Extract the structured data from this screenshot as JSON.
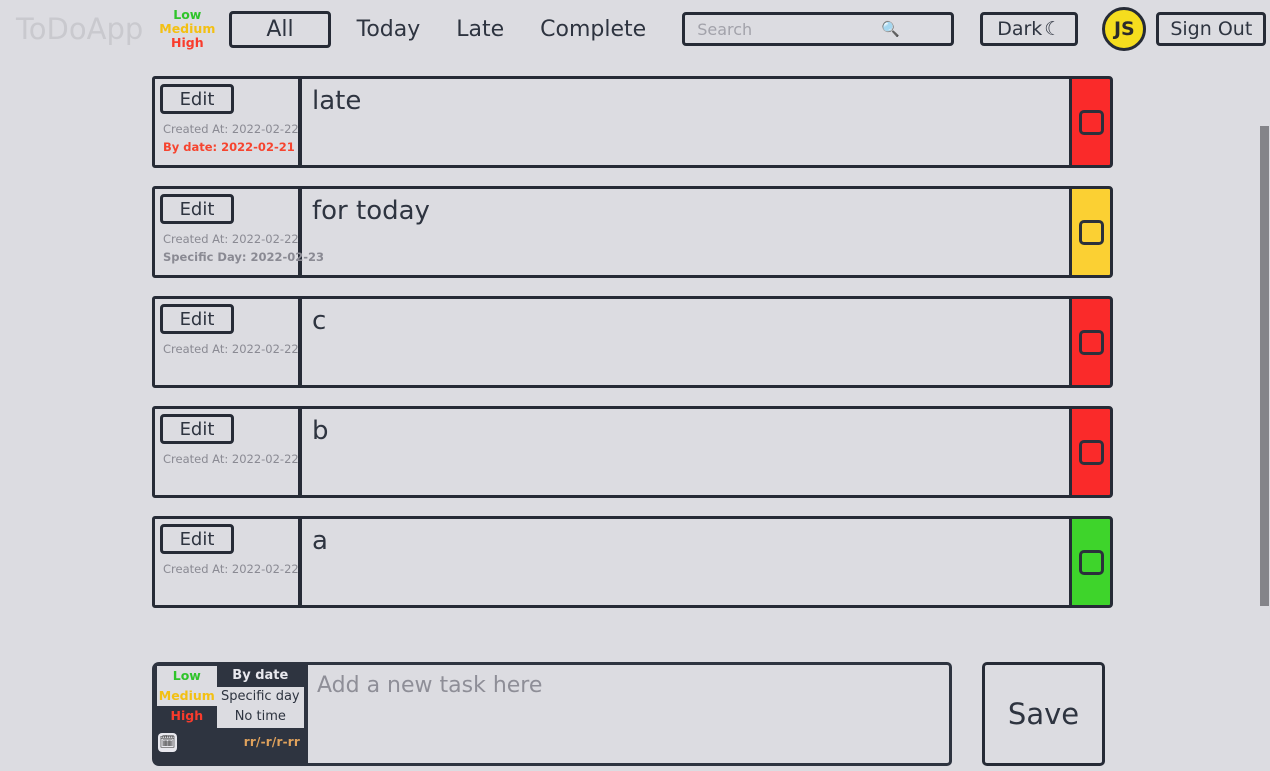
{
  "header": {
    "brand": "ToDoApp",
    "priority_legend": [
      {
        "label": "Low",
        "color": "#2fc42a"
      },
      {
        "label": "Medium",
        "color": "#f3c013"
      },
      {
        "label": "High",
        "color": "#f93b2c"
      }
    ],
    "nav": [
      {
        "label": "All",
        "active": true
      },
      {
        "label": "Today",
        "active": false
      },
      {
        "label": "Late",
        "active": false
      },
      {
        "label": "Complete",
        "active": false
      }
    ],
    "search": {
      "placeholder": "Search",
      "value": "",
      "icon": "search-icon"
    },
    "dark_button": {
      "label": "Dark",
      "icon": "moon-icon"
    },
    "avatar": {
      "initials": "JS",
      "bg": "#f5dd1e"
    },
    "sign_out": {
      "label": "Sign Out"
    }
  },
  "tasks": [
    {
      "edit_label": "Edit",
      "created": "Created At: 2022-02-22",
      "due": "By date: 2022-02-21",
      "due_late": true,
      "text": "late",
      "status_color": "#fa2a2a",
      "status": "overdue",
      "checked": false
    },
    {
      "edit_label": "Edit",
      "created": "Created At: 2022-02-22",
      "due": "Specific Day: 2022-02-23",
      "due_late": false,
      "text": "for today",
      "status_color": "#fbd033",
      "status": "today",
      "checked": false
    },
    {
      "edit_label": "Edit",
      "created": "Created At: 2022-02-22",
      "due": "",
      "due_late": false,
      "text": "c",
      "status_color": "#fa2a2a",
      "status": "incomplete",
      "checked": false
    },
    {
      "edit_label": "Edit",
      "created": "Created At: 2022-02-22",
      "due": "",
      "due_late": false,
      "text": "b",
      "status_color": "#fa2a2a",
      "status": "incomplete",
      "checked": false
    },
    {
      "edit_label": "Edit",
      "created": "Created At: 2022-02-22",
      "due": "",
      "due_late": false,
      "text": "a",
      "status_color": "#3ed42b",
      "status": "complete",
      "checked": false
    }
  ],
  "new_task": {
    "priority_options": [
      {
        "label": "Low",
        "selected": true
      },
      {
        "label": "Medium",
        "selected": true
      },
      {
        "label": "High",
        "selected": false
      }
    ],
    "time_options": [
      {
        "label": "By date",
        "selected": true
      },
      {
        "label": "Specific day",
        "selected": false
      },
      {
        "label": "No time",
        "selected": false
      }
    ],
    "calendar_icon": "calendar-icon",
    "date_placeholder": "rr/-r/r-rr",
    "input_placeholder": "Add a new task here",
    "input_value": "",
    "save_label": "Save"
  }
}
